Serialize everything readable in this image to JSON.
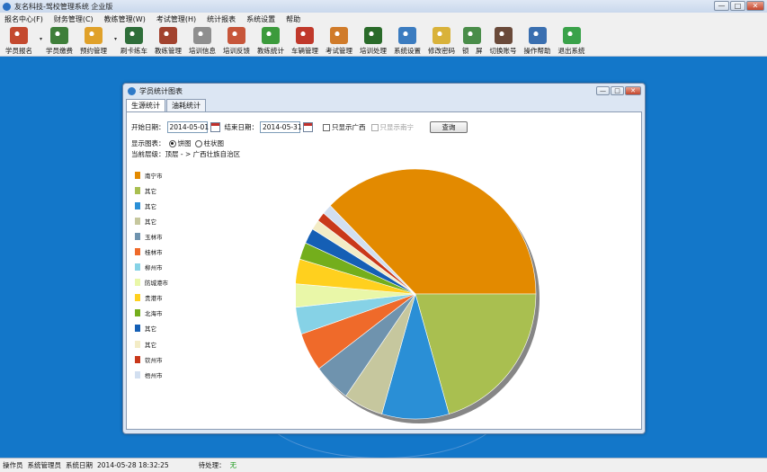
{
  "app": {
    "title": "友名科技-驾校管理系统 企业版",
    "window_buttons": [
      "—",
      "□",
      "✕"
    ]
  },
  "menu": [
    "报名中心(F)",
    "财务管理(C)",
    "教练管理(W)",
    "考试管理(H)",
    "统计报表",
    "系统设置",
    "帮助"
  ],
  "toolbar": [
    {
      "label": "学员报名",
      "icon": "student-enroll-icon",
      "color": "#c44a2f"
    },
    {
      "label": "学员缴费",
      "icon": "payment-icon",
      "color": "#3f7f3a"
    },
    {
      "label": "预约管理",
      "icon": "appointment-icon",
      "color": "#e0a12a"
    },
    {
      "label": "刷卡练车",
      "icon": "card-swipe-icon",
      "color": "#2f6e3a"
    },
    {
      "label": "教练管理",
      "icon": "coach-icon",
      "color": "#a2432f"
    },
    {
      "label": "培训信息",
      "icon": "training-info-icon",
      "color": "#8f8f8f"
    },
    {
      "label": "培训反馈",
      "icon": "feedback-icon",
      "color": "#c7563a"
    },
    {
      "label": "教练统计",
      "icon": "coach-stats-icon",
      "color": "#3c9b3c"
    },
    {
      "label": "车辆管理",
      "icon": "vehicle-icon",
      "color": "#c0392b"
    },
    {
      "label": "考试管理",
      "icon": "exam-icon",
      "color": "#d07b2a"
    },
    {
      "label": "培训处理",
      "icon": "training-process-icon",
      "color": "#2a6b2a"
    },
    {
      "label": "系统设置",
      "icon": "settings-icon",
      "color": "#3b7cc0"
    },
    {
      "label": "修改密码",
      "icon": "password-icon",
      "color": "#d9b23a"
    },
    {
      "label": "锁　屏",
      "icon": "lock-screen-icon",
      "color": "#4a8d4a"
    },
    {
      "label": "切换账号",
      "icon": "switch-account-icon",
      "color": "#6a4a3a"
    },
    {
      "label": "操作帮助",
      "icon": "help-icon",
      "color": "#3a6fb0"
    },
    {
      "label": "退出系统",
      "icon": "exit-icon",
      "color": "#3aa24a"
    }
  ],
  "dialog": {
    "title": "学员统计图表",
    "tabs": [
      "生源统计",
      "油耗统计"
    ],
    "filters": {
      "start_label": "开始日期：",
      "start_value": "2014-05-01",
      "end_label": "结束日期：",
      "end_value": "2014-05-31",
      "only_guangxi": "只显示广西",
      "only_nanning": "只显示南宁",
      "query_button": "查询"
    },
    "display": {
      "label": "显示图表：",
      "pie": "饼图",
      "bar": "柱状图"
    },
    "level": {
      "label": "当前层级：",
      "path": "顶层 - > 广西壮族自治区"
    }
  },
  "chart_data": {
    "type": "pie",
    "labels": [
      "南宁市",
      "其它",
      "其它",
      "其它",
      "玉林市",
      "桂林市",
      "柳州市",
      "防城港市",
      "贵港市",
      "北海市",
      "其它",
      "其它",
      "钦州市",
      "梧州市"
    ],
    "values": [
      37.5,
      20.5,
      9.0,
      5.3,
      5.0,
      5.0,
      3.5,
      3.0,
      3.2,
      2.2,
      2.0,
      1.3,
      1.2,
      1.3
    ],
    "colors": [
      "#e38a00",
      "#a9bf50",
      "#2a8fd6",
      "#c6c79e",
      "#6f93ae",
      "#ef6a2a",
      "#86d2e6",
      "#e9f7a8",
      "#ffd01e",
      "#74ae1c",
      "#155fb5",
      "#f3ecc6",
      "#c9381a",
      "#d2dff0"
    ],
    "legend_placement": "left"
  },
  "status": {
    "operator_label": "操作员",
    "operator_value": "系统管理员",
    "date_label": "系统日期",
    "date_value": "2014-05-28 18:32:25",
    "pending_label": "待处理：",
    "pending_value": "无"
  }
}
